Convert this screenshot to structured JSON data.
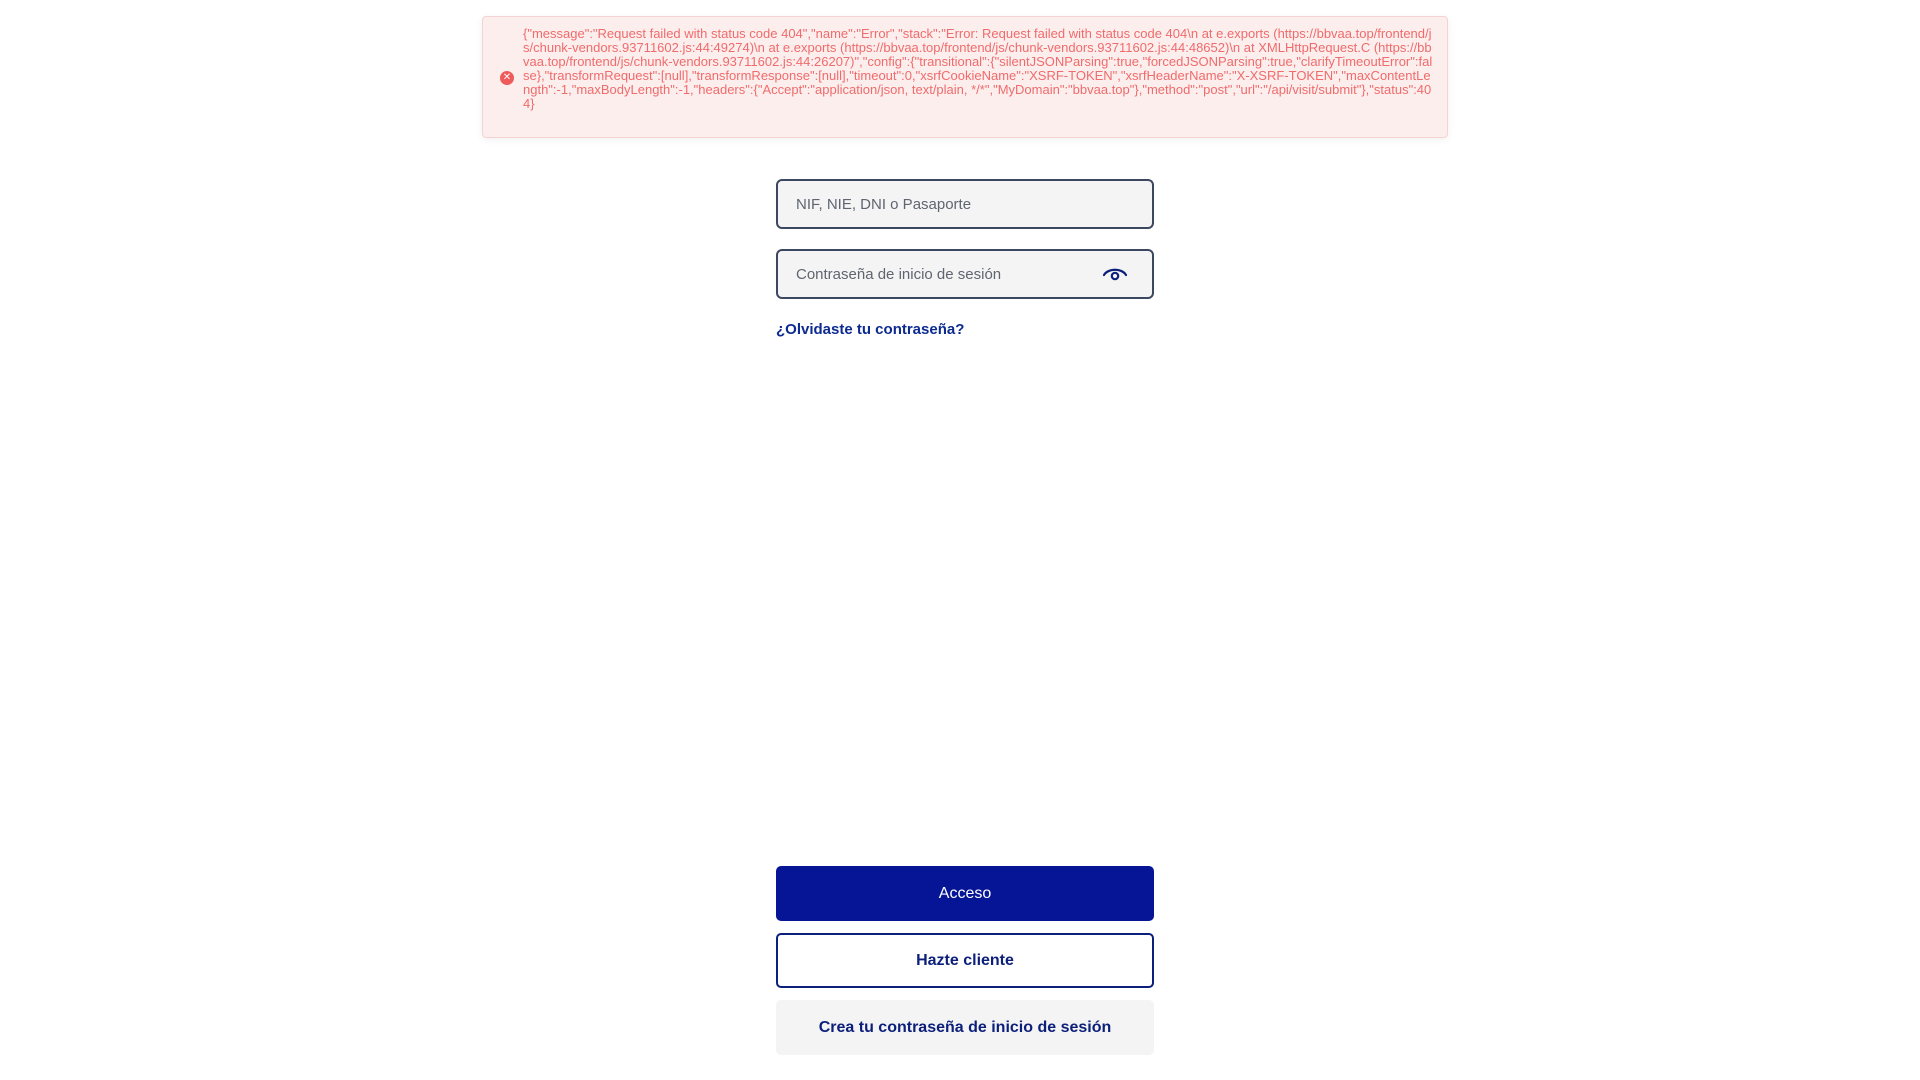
{
  "error": {
    "icon": "error-circle-icon",
    "message": "{\"message\":\"Request failed with status code 404\",\"name\":\"Error\",\"stack\":\"Error: Request failed with status code 404\\n at e.exports (https://bbvaa.top/frontend/js/chunk-vendors.93711602.js:44:49274)\\n at e.exports (https://bbvaa.top/frontend/js/chunk-vendors.93711602.js:44:48652)\\n at XMLHttpRequest.C (https://bbvaa.top/frontend/js/chunk-vendors.93711602.js:44:26207)\",\"config\":{\"transitional\":{\"silentJSONParsing\":true,\"forcedJSONParsing\":true,\"clarifyTimeoutError\":false},\"transformRequest\":[null],\"transformResponse\":[null],\"timeout\":0,\"xsrfCookieName\":\"XSRF-TOKEN\",\"xsrfHeaderName\":\"X-XSRF-TOKEN\",\"maxContentLength\":-1,\"maxBodyLength\":-1,\"headers\":{\"Accept\":\"application/json, text/plain, */*\",\"MyDomain\":\"bbvaa.top\"},\"method\":\"post\",\"url\":\"/api/visit/submit\"},\"status\":404}",
    "colors": {
      "background": "#fdeeee",
      "text": "#f06b6b",
      "icon": "#ef5a5a"
    }
  },
  "login": {
    "user_field": {
      "placeholder": "NIF, NIE, DNI o Pasaporte",
      "value": ""
    },
    "password_field": {
      "placeholder": "Contraseña de inicio de sesión",
      "value": "",
      "toggle_icon": "eye-icon"
    },
    "forgot_link": "¿Olvidaste tu contraseña?"
  },
  "actions": {
    "access_label": "Acceso",
    "become_client_label": "Hazte cliente",
    "create_password_label": "Crea tu contraseña de inicio de sesión"
  },
  "colors": {
    "primary": "#061595",
    "link": "#0c2a8f"
  }
}
